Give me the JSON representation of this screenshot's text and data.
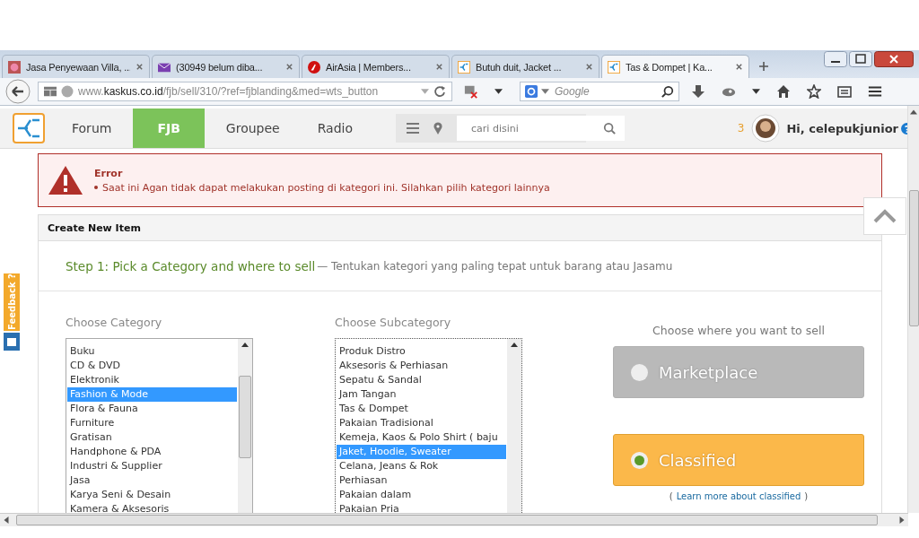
{
  "browser": {
    "tabs": [
      {
        "title": "Jasa Penyewaan Villa, ...",
        "kind": "photo",
        "selected": false
      },
      {
        "title": "(30949 belum diba...",
        "kind": "mail",
        "selected": false
      },
      {
        "title": "AirAsia | Members...",
        "kind": "airline",
        "selected": false
      },
      {
        "title": "Butuh duit, Jacket ...",
        "kind": "site",
        "selected": false
      },
      {
        "title": "Tas & Dompet | Ka...",
        "kind": "site",
        "selected": true
      }
    ],
    "address": "www.**kaskus.co.id**/fjb/sell/310/?ref=fjblanding&med=wts_button",
    "search": {
      "placeholder": "Google"
    }
  },
  "site": {
    "nav": [
      {
        "label": "Forum",
        "selected": false
      },
      {
        "label": "FJB",
        "selected": true
      },
      {
        "label": "Groupee",
        "selected": false
      },
      {
        "label": "Radio",
        "selected": false
      }
    ],
    "search": {
      "placeholder": "cari disini"
    },
    "notification_count": "3",
    "greeting": "Hi, celepukjunior"
  },
  "error": {
    "title": "Error",
    "message": "Saat ini Agan tidak dapat melakukan posting di kategori ini. Silahkan pilih kategori lainnya"
  },
  "panel": {
    "title": "Create New Item",
    "step_title": "Step 1: Pick a Category and where to sell",
    "step_hint": "— Tentukan kategori yang paling tepat untuk barang atau Jasamu"
  },
  "category": {
    "label": "Choose Category",
    "options": [
      {
        "label": "Buku",
        "selected": false
      },
      {
        "label": "CD & DVD",
        "selected": false
      },
      {
        "label": "Elektronik",
        "selected": false
      },
      {
        "label": "Fashion & Mode",
        "selected": true
      },
      {
        "label": "Flora & Fauna",
        "selected": false
      },
      {
        "label": "Furniture",
        "selected": false
      },
      {
        "label": "Gratisan",
        "selected": false
      },
      {
        "label": "Handphone & PDA",
        "selected": false
      },
      {
        "label": "Industri & Supplier",
        "selected": false
      },
      {
        "label": "Jasa",
        "selected": false
      },
      {
        "label": "Karya Seni & Desain",
        "selected": false
      },
      {
        "label": "Kamera & Aksesoris",
        "selected": false
      }
    ]
  },
  "subcategory": {
    "label": "Choose Subcategory",
    "options": [
      {
        "label": "Produk Distro",
        "selected": false
      },
      {
        "label": "Aksesoris & Perhiasan",
        "selected": false
      },
      {
        "label": "Sepatu & Sandal",
        "selected": false
      },
      {
        "label": "Jam Tangan",
        "selected": false
      },
      {
        "label": "Tas & Dompet",
        "selected": false
      },
      {
        "label": "Pakaian Tradisional",
        "selected": false
      },
      {
        "label": "Kemeja, Kaos & Polo Shirt ( baju",
        "selected": false
      },
      {
        "label": "Jaket, Hoodie, Sweater",
        "selected": true
      },
      {
        "label": "Celana, Jeans & Rok",
        "selected": false
      },
      {
        "label": "Perhiasan",
        "selected": false
      },
      {
        "label": "Pakaian dalam",
        "selected": false
      },
      {
        "label": "Pakaian Pria",
        "selected": false
      }
    ]
  },
  "sell": {
    "label": "Choose where you want to sell",
    "options": [
      {
        "label": "Marketplace",
        "selected": false
      },
      {
        "label": "Classified",
        "selected": true
      }
    ],
    "link": "Learn more about classified",
    "link_open": "(",
    "link_close": ")"
  },
  "feedback": "Feedback ?"
}
